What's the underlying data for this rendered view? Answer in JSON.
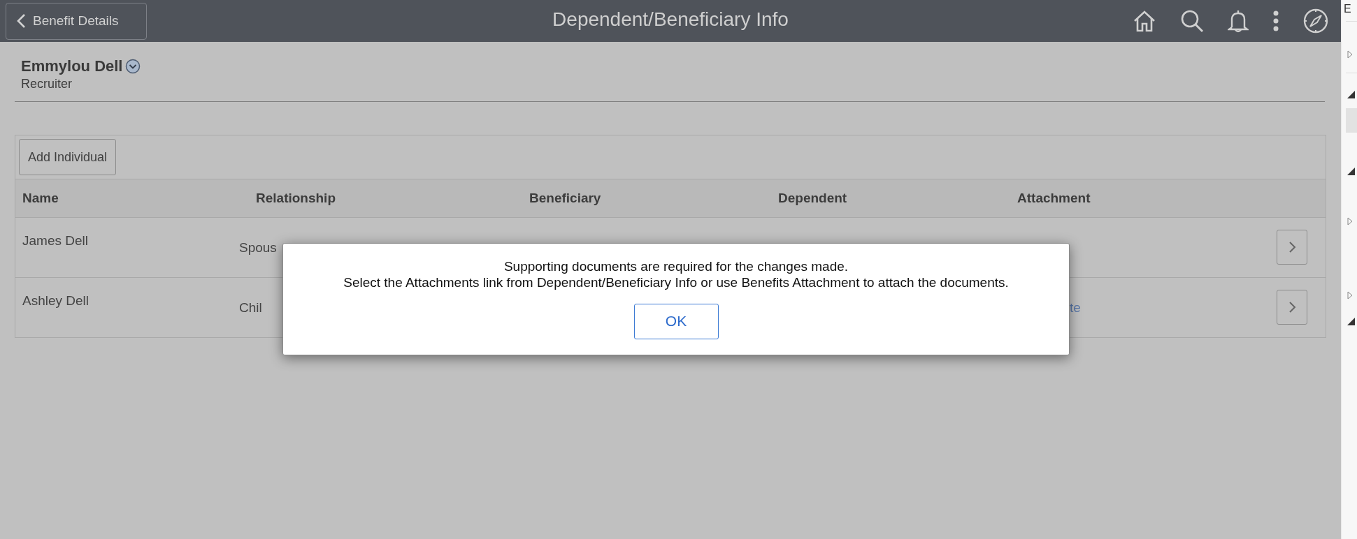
{
  "header": {
    "back_button": "Benefit Details",
    "title": "Dependent/Beneficiary Info"
  },
  "employee": {
    "name": "Emmylou Dell",
    "job_title": "Recruiter"
  },
  "toolbar": {
    "add_button": "Add Individual"
  },
  "table": {
    "columns": [
      "Name",
      "Relationship",
      "Beneficiary",
      "Dependent",
      "Attachment"
    ],
    "rows": [
      {
        "name": "James Dell",
        "relationship": "Spous"
      },
      {
        "name": "Ashley Dell",
        "relationship": "Chil",
        "attachment": "te"
      }
    ]
  },
  "dialog": {
    "lines": [
      "Supporting documents are required for the changes made.",
      "Select the Attachments link from Dependent/Beneficiary Info or use Benefits Attachment to attach the documents."
    ],
    "ok_button": "OK"
  },
  "side_panel": {
    "label": "E"
  }
}
